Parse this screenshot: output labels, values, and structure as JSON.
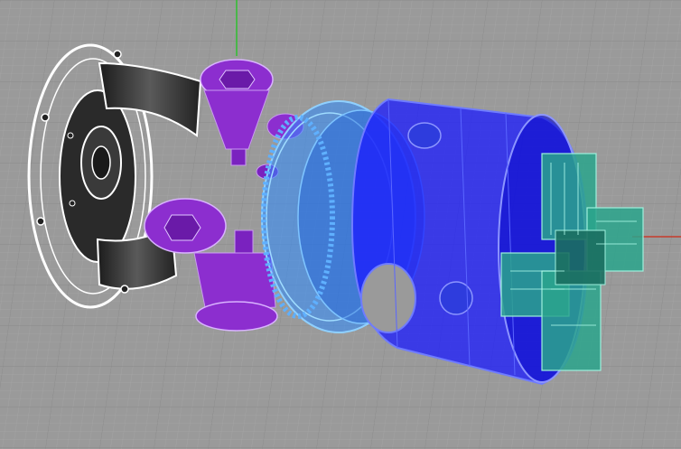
{
  "viewport": {
    "background": "#9a9a9a",
    "grid_minor_color": "#a6a6a6",
    "grid_major_color": "#8a8a8a",
    "axis_y_color": "#2fbf2f",
    "axis_x_color": "#c43a2a"
  },
  "parts": {
    "housing": {
      "color": "#ffffff",
      "shade": "#2b2b2b"
    },
    "bevel_pinions": {
      "color": "#8c2ecf",
      "shade": "#6a1aa8"
    },
    "ring_gear": {
      "color": "#2f8dff",
      "shade": "#1c5fd6"
    },
    "carrier": {
      "color": "#1a1aff",
      "shade": "#0a0acc"
    },
    "cross_coupling": {
      "color": "#2aa58c",
      "shade": "#1b6f60"
    }
  }
}
